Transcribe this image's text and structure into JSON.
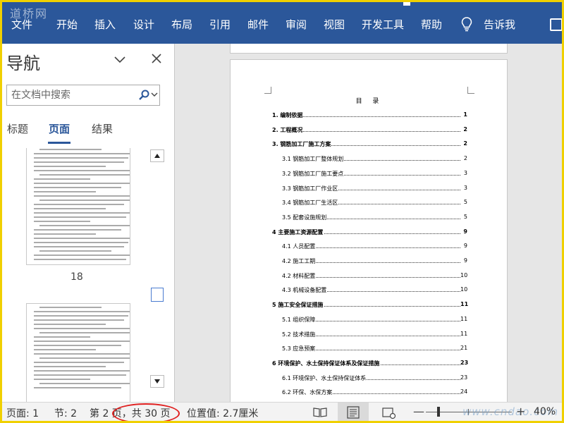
{
  "watermark_logo": "道桥网",
  "ribbon": {
    "tabs": [
      "文件",
      "开始",
      "插入",
      "设计",
      "布局",
      "引用",
      "邮件",
      "审阅",
      "视图",
      "开发工具",
      "帮助"
    ],
    "tell_me": "告诉我"
  },
  "nav_pane": {
    "title": "导航",
    "search_placeholder": "在文档中搜索",
    "tabs": [
      "标题",
      "页面",
      "结果"
    ],
    "active_tab": "页面",
    "thumbnails": [
      {
        "page": "18"
      },
      {
        "page": ""
      }
    ]
  },
  "document": {
    "toc_title": "目 录",
    "toc": [
      {
        "label": "1. 编制依据",
        "page": "1",
        "level": 1
      },
      {
        "label": "2. 工程概况",
        "page": "2",
        "level": 1
      },
      {
        "label": "3. 钢筋加工厂施工方案",
        "page": "2",
        "level": 1
      },
      {
        "label": "3.1 钢筋加工厂整体规划",
        "page": "2",
        "level": 2
      },
      {
        "label": "3.2 钢筋加工厂施工要点",
        "page": "3",
        "level": 2
      },
      {
        "label": "3.3 钢筋加工厂作业区",
        "page": "3",
        "level": 2
      },
      {
        "label": "3.4 钢筋加工厂生活区",
        "page": "5",
        "level": 2
      },
      {
        "label": "3.5 配套设施规划",
        "page": "5",
        "level": 2
      },
      {
        "label": "4 主要施工资源配置",
        "page": "9",
        "level": 1
      },
      {
        "label": "4.1 人员配置",
        "page": "9",
        "level": 2
      },
      {
        "label": "4.2 施工工期",
        "page": "9",
        "level": 2
      },
      {
        "label": "4.2 材料配置",
        "page": "10",
        "level": 2
      },
      {
        "label": "4.3 机械设备配置",
        "page": "10",
        "level": 2
      },
      {
        "label": "5 施工安全保证措施",
        "page": "11",
        "level": 1
      },
      {
        "label": "5.1 组织保障",
        "page": "11",
        "level": 2
      },
      {
        "label": "5.2 技术措施",
        "page": "11",
        "level": 2
      },
      {
        "label": "5.3 应急预案",
        "page": "21",
        "level": 2
      },
      {
        "label": "6 环境保护、水土保持保证体系及保证措施",
        "page": "23",
        "level": 1
      },
      {
        "label": "6.1 环境保护、水土保持保证体系",
        "page": "23",
        "level": 2
      },
      {
        "label": "6.2 环保、水保方案",
        "page": "24",
        "level": 2
      }
    ]
  },
  "status_bar": {
    "page": "页面: 1",
    "section": "节: 2",
    "page_of": "第 2 页，共 30 页",
    "position": "位置值: 2.7厘米",
    "zoom": "40%"
  },
  "site_watermark": "www.cndao.com",
  "colors": {
    "ribbon": "#2b579a",
    "highlight": "#e02020",
    "frame": "#f0d000"
  }
}
